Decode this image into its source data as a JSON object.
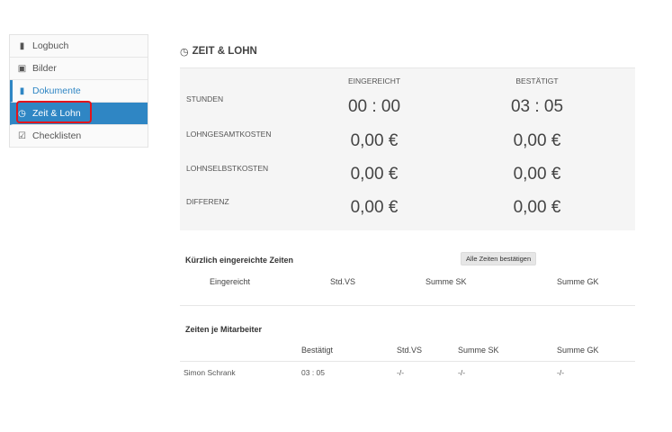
{
  "sidebar": {
    "items": [
      {
        "label": "Logbuch",
        "icon": "book-icon"
      },
      {
        "label": "Bilder",
        "icon": "image-icon"
      },
      {
        "label": "Dokumente",
        "icon": "file-icon"
      },
      {
        "label": "Zeit & Lohn",
        "icon": "clock-icon"
      },
      {
        "label": "Checklisten",
        "icon": "checkbox-icon"
      }
    ]
  },
  "page": {
    "title": "ZEIT & LOHN"
  },
  "summary": {
    "columns": [
      "EINGEREICHT",
      "BESTÄTIGT"
    ],
    "rows": [
      {
        "label": "STUNDEN",
        "submitted": "00 : 00",
        "confirmed": "03 : 05"
      },
      {
        "label": "LOHNGESAMTKOSTEN",
        "submitted": "0,00 €",
        "confirmed": "0,00 €"
      },
      {
        "label": "LOHNSELBSTKOSTEN",
        "submitted": "0,00 €",
        "confirmed": "0,00 €"
      },
      {
        "label": "DIFFERENZ",
        "submitted": "0,00 €",
        "confirmed": "0,00 €"
      }
    ]
  },
  "recent": {
    "title": "Kürzlich eingereichte Zeiten",
    "confirm_all_label": "Alle Zeiten bestätigen",
    "headers": [
      "Eingereicht",
      "Std.VS",
      "Summe SK",
      "Summe GK"
    ]
  },
  "per_employee": {
    "title": "Zeiten je Mitarbeiter",
    "headers": [
      "Bestätigt",
      "Std.VS",
      "Summe SK",
      "Summe GK"
    ],
    "rows": [
      {
        "name": "Simon Schrank",
        "confirmed": "03 : 05",
        "std_vs": "-/-",
        "summe_sk": "-/-",
        "summe_gk": "-/-"
      }
    ]
  },
  "colors": {
    "accent": "#2f86c4",
    "highlight": "#e3141b"
  }
}
